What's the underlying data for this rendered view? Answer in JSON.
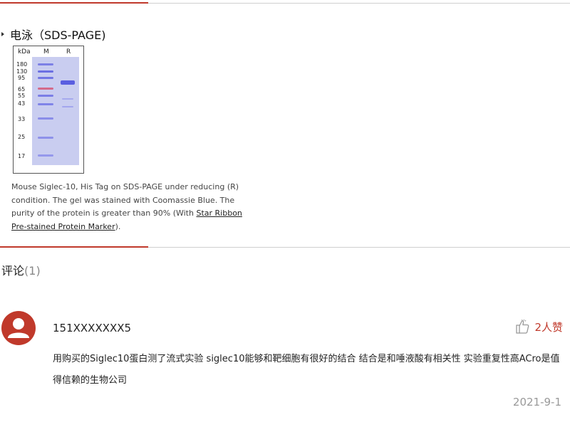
{
  "section": {
    "title": "电泳（SDS-PAGE)"
  },
  "gel": {
    "unit_label": "kDa",
    "lane_labels": [
      "M",
      "R"
    ],
    "markers": [
      "180",
      "130",
      "95",
      "65",
      "55",
      "43",
      "33",
      "25",
      "17"
    ]
  },
  "caption": {
    "text": "Mouse Siglec-10, His Tag on SDS-PAGE under reducing (R) condition. The gel was stained with Coomassie Blue. The purity of the protein is greater than 90% (With ",
    "link_text": "Star Ribbon Pre-stained Protein Marker",
    "tail": ")."
  },
  "comments": {
    "label": "评论",
    "count": "(1)"
  },
  "comment": {
    "username": "151XXXXXXX5",
    "likes": "2人赞",
    "text": "用购买的Siglec10蛋白测了流式实验 siglec10能够和靶细胞有很好的结合 结合是和唾液酸有相关性 实验重复性高ACro是值得信赖的生物公司",
    "date": "2021-9-1"
  },
  "colors": {
    "accent": "#c0392b",
    "gel_bg": "#c9cdf0",
    "band": "#6a6ee0"
  },
  "icons": {
    "avatar": "user-avatar-icon",
    "like": "thumbs-up-icon"
  }
}
